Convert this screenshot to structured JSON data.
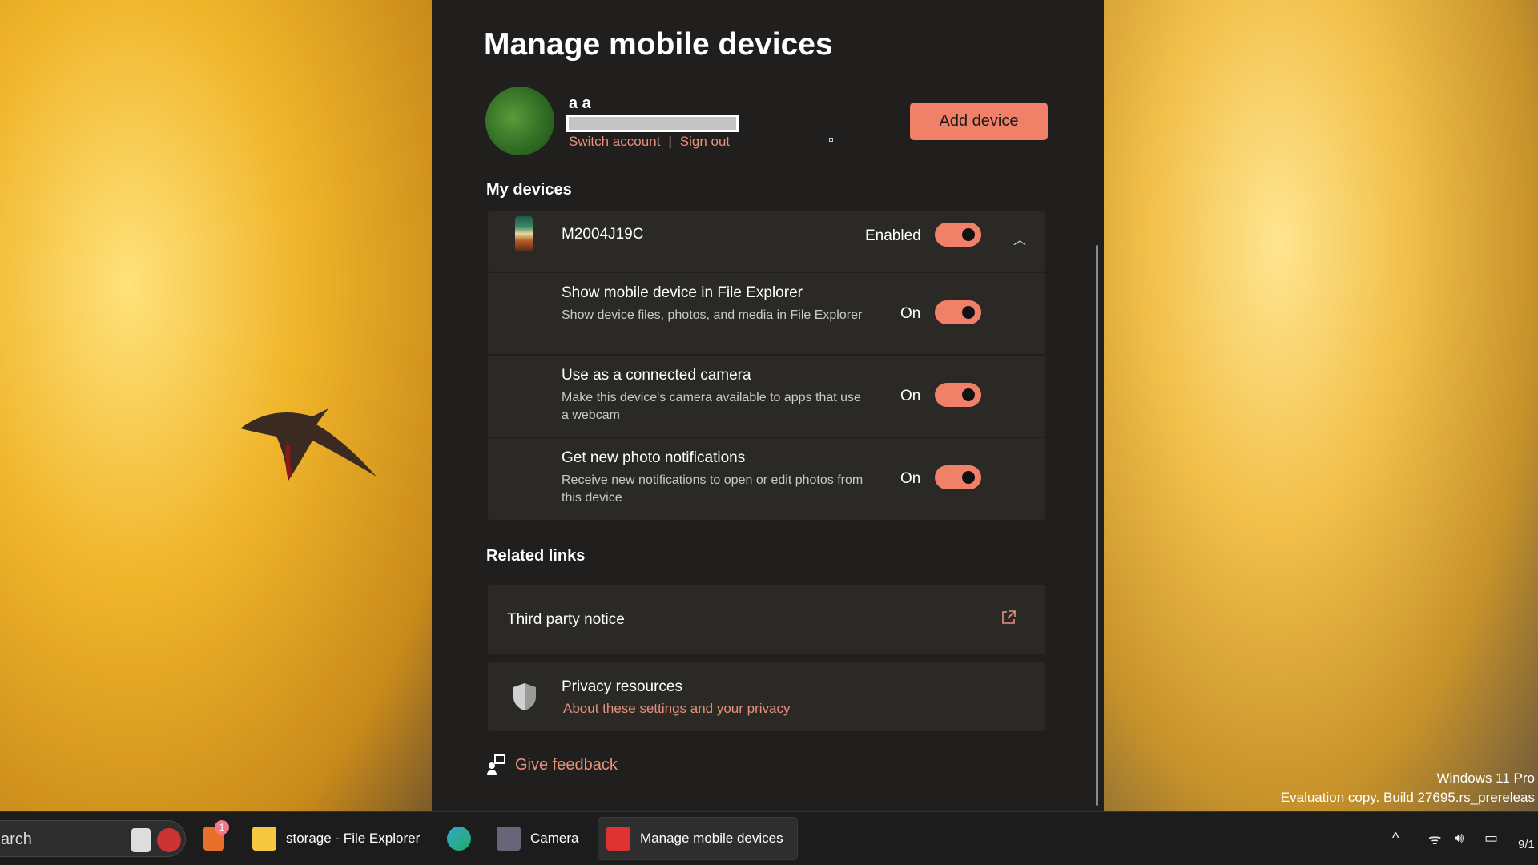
{
  "window": {
    "title": "Manage mobile devices"
  },
  "account": {
    "name": "a a",
    "switch_label": "Switch account",
    "separator": "|",
    "signout_label": "Sign out"
  },
  "add_device_label": "Add device",
  "my_devices": {
    "heading": "My devices",
    "device": {
      "name": "M2004J19C",
      "status_label": "Enabled",
      "enabled": true
    },
    "settings": [
      {
        "title": "Show mobile device in File Explorer",
        "description": "Show device files, photos, and media in File Explorer",
        "state_label": "On",
        "on": true
      },
      {
        "title": "Use as a connected camera",
        "description": "Make this device's camera available to apps that use a webcam",
        "state_label": "On",
        "on": true
      },
      {
        "title": "Get new photo notifications",
        "description": "Receive new notifications to open or edit photos from this device",
        "state_label": "On",
        "on": true
      }
    ]
  },
  "related": {
    "heading": "Related links",
    "third_party": "Third party notice",
    "privacy_title": "Privacy resources",
    "privacy_link": "About these settings and your privacy"
  },
  "feedback_label": "Give feedback",
  "watermark": {
    "line1": "Windows 11 Pro",
    "line2": "Evaluation copy. Build 27695.rs_prereleas"
  },
  "taskbar": {
    "search_text": "arch",
    "badge": "1",
    "items": [
      {
        "label": "storage - File Explorer"
      },
      {
        "label": ""
      },
      {
        "label": "Camera"
      },
      {
        "label": "Manage mobile devices"
      }
    ],
    "clock_partial": "9/1"
  },
  "colors": {
    "accent": "#f08068",
    "panel": "#201f1d",
    "card": "#2b2926"
  }
}
